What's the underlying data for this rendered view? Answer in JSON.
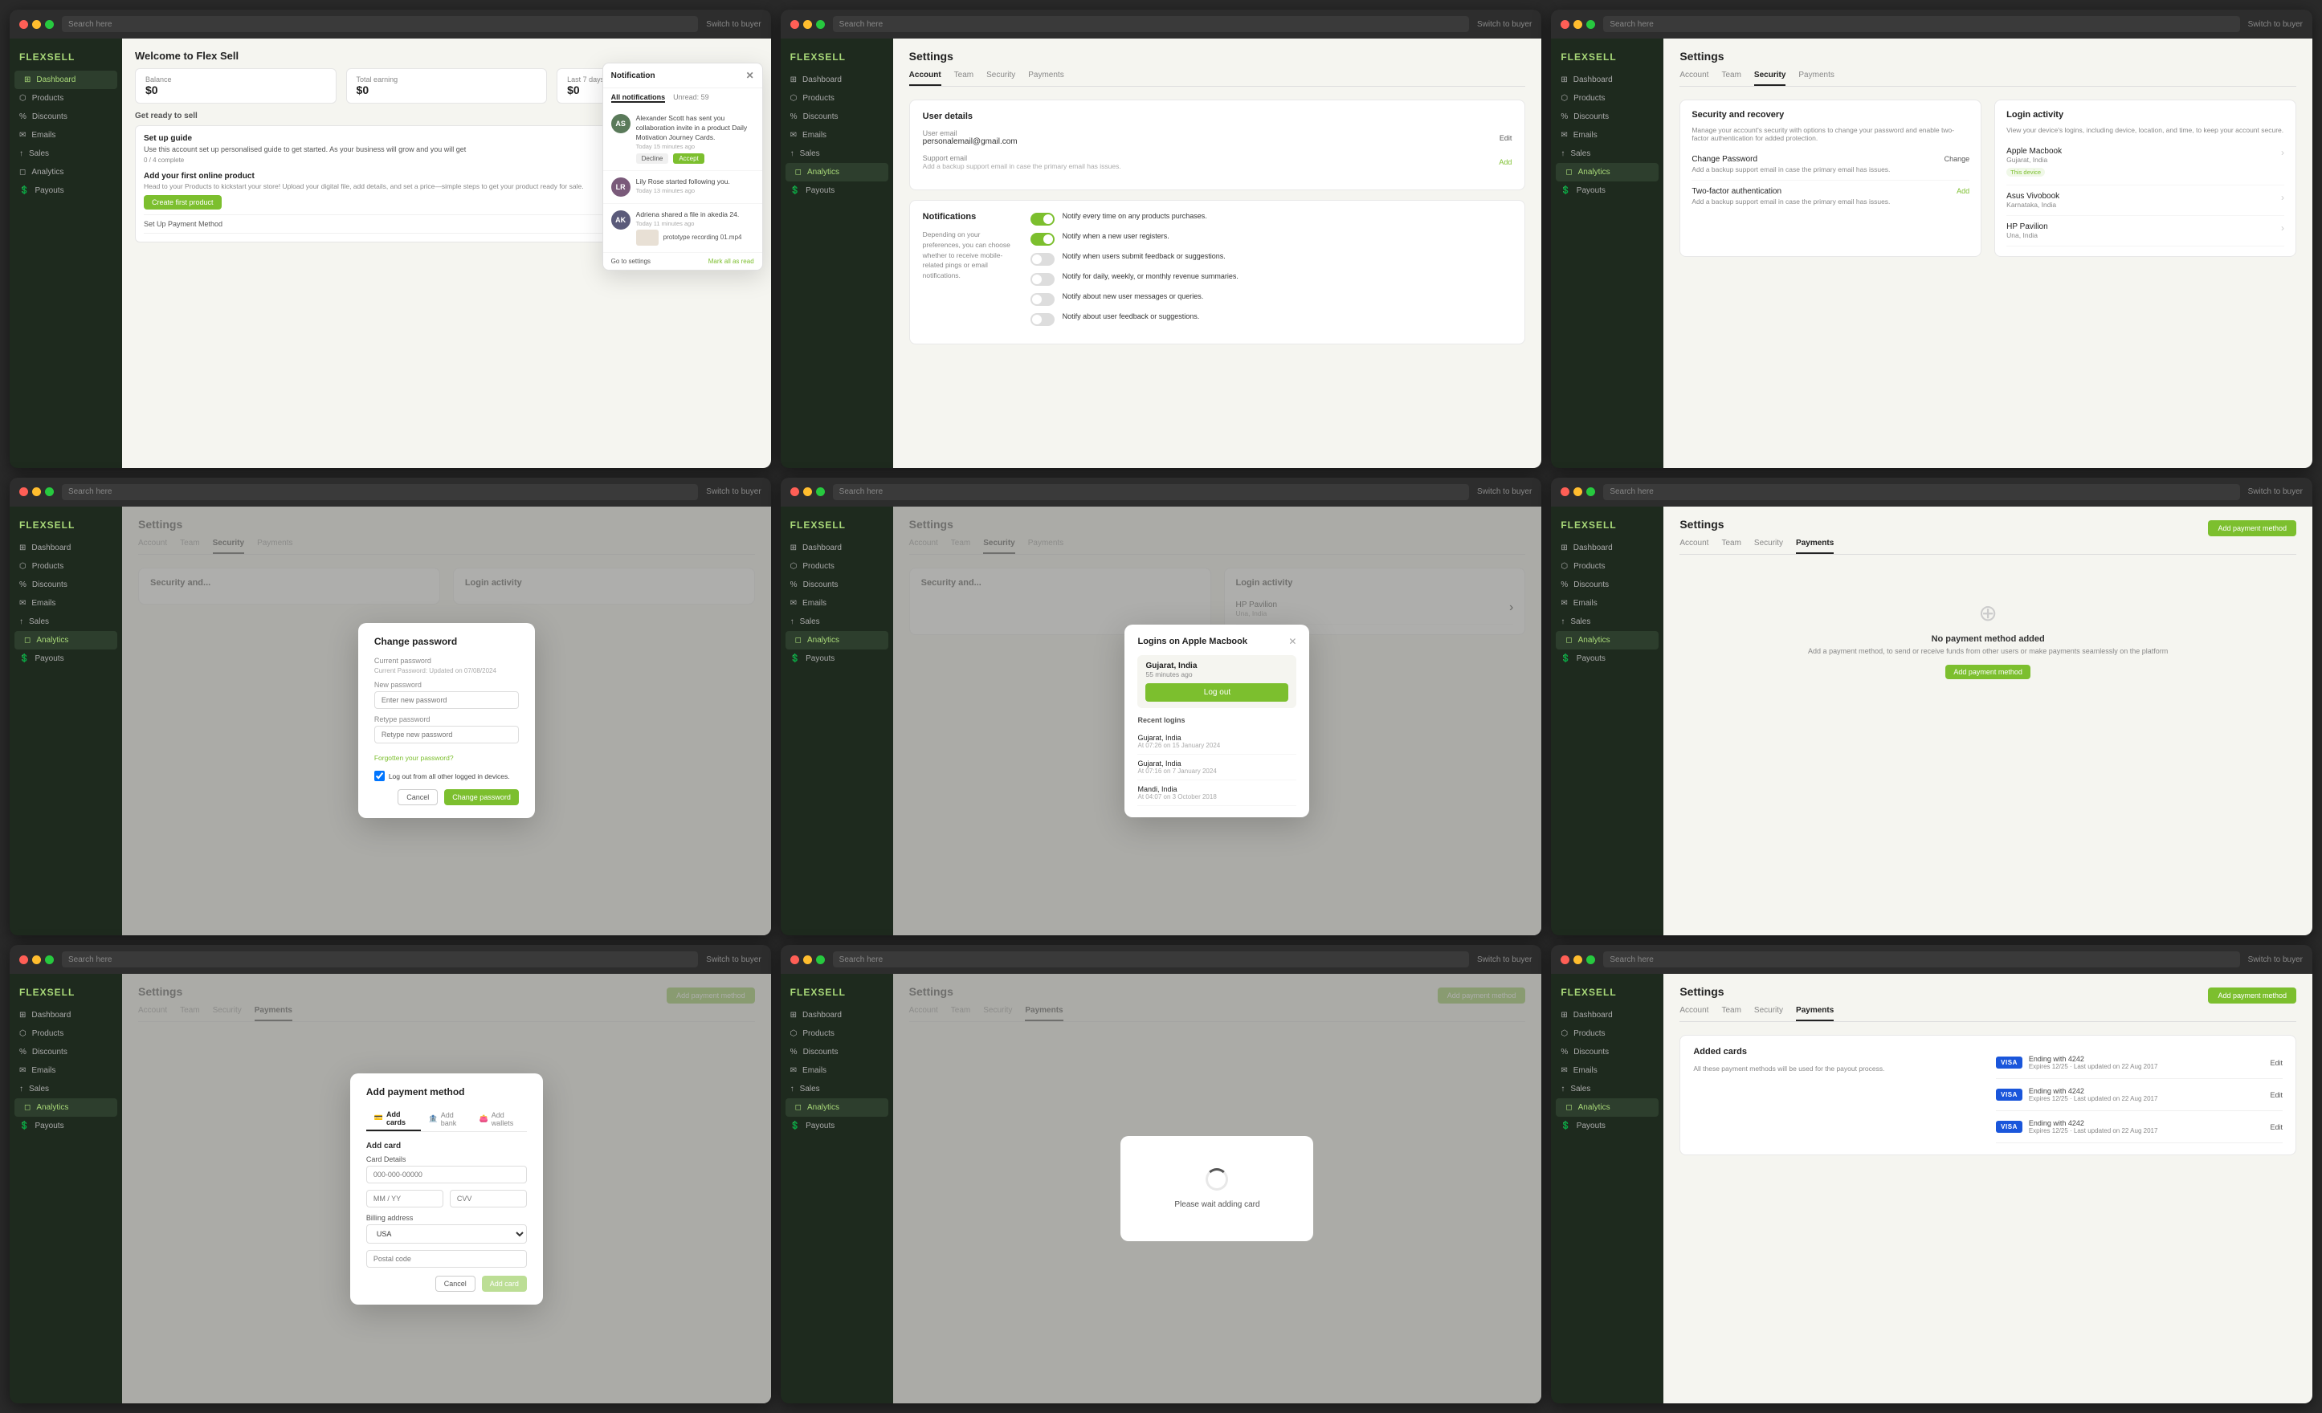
{
  "brand": "FLEXSELL",
  "search_placeholder": "Search here",
  "switch_to_buyer": "Switch to buyer",
  "sidebar": {
    "items": [
      {
        "label": "Dashboard",
        "icon": "⊞",
        "active": false
      },
      {
        "label": "Products",
        "icon": "⬡",
        "active": false
      },
      {
        "label": "Discounts",
        "icon": "%",
        "active": false
      },
      {
        "label": "Emails",
        "icon": "✉",
        "active": false
      },
      {
        "label": "Sales",
        "icon": "↑",
        "active": false
      },
      {
        "label": "Analytics",
        "icon": "◻",
        "active": true
      },
      {
        "label": "Payouts",
        "icon": "💲",
        "active": false
      }
    ]
  },
  "panel1": {
    "title": "Welcome to Flex Sell",
    "stats": [
      {
        "label": "Balance",
        "value": "$0"
      },
      {
        "label": "Total earning",
        "value": "$0"
      },
      {
        "label": "Last 7 days",
        "value": "$0"
      }
    ],
    "setup": {
      "title": "Get ready to sell",
      "subtitle": "Set up guide",
      "desc": "Use this account set up personalised guide to get started. As your business will grow and you will get",
      "progress": "0 / 4 complete",
      "items": [
        {
          "text": "Add your first online product",
          "desc": "Head to your Products to kickstart your store! Upload your digital file, add details, and set a price—simple steps to get your product ready for sale.",
          "btn": "Create first product"
        },
        {
          "text": "Set Up Payment Method"
        }
      ]
    },
    "notification": {
      "title": "Notification",
      "unread": "Unread: 59",
      "tabs": [
        "All notifications",
        "Unread 59"
      ],
      "items": [
        {
          "avatar_text": "AS",
          "avatar_color": "#5a7a5a",
          "text": "Alexander Scott has sent you collaboration invite in a product Daily Motivation Journey Cards.",
          "time": "Today 15 minutes ago",
          "actions": [
            "Decline",
            "Accept"
          ]
        },
        {
          "avatar_text": "LR",
          "avatar_color": "#7a5a7a",
          "text": "Lily Rose started following you.",
          "time": "Today 13 minutes ago"
        },
        {
          "avatar_text": "AK",
          "avatar_color": "#5a5a7a",
          "text": "Adriena shared a file in akedia 24.",
          "time": "Today 11 minutes ago",
          "has_attachment": true,
          "attachment": "prototype recording 01.mp4"
        }
      ],
      "footer": {
        "settings": "Go to settings",
        "mark_all": "Mark all as read"
      }
    }
  },
  "panel2": {
    "title": "Settings",
    "tabs": [
      "Account",
      "Team",
      "Security",
      "Payments"
    ],
    "active_tab": "Account",
    "user_details": {
      "title": "User details",
      "user_email_label": "User email",
      "user_email": "personalemail@gmail.com",
      "user_email_action": "Edit",
      "support_email_label": "Support email",
      "support_email_desc": "Add a backup support email in case the primary email has issues.",
      "support_email_action": "Add"
    },
    "notifications": {
      "title": "Notifications",
      "desc": "Depending on your preferences, you can choose whether to receive mobile-related pings or email notifications.",
      "items": [
        {
          "text": "Notify every time on any products purchases.",
          "enabled": true
        },
        {
          "text": "Notify when a new user registers.",
          "enabled": true
        },
        {
          "text": "Notify when users submit feedback or suggestions.",
          "enabled": false
        },
        {
          "text": "Notify for daily, weekly, or monthly revenue summaries.",
          "enabled": false
        },
        {
          "text": "Notify about new user messages or queries.",
          "enabled": false
        },
        {
          "text": "Notify about user feedback or suggestions.",
          "enabled": false
        }
      ]
    }
  },
  "panel3": {
    "title": "Settings",
    "tabs": [
      "Account",
      "Team",
      "Security",
      "Payments"
    ],
    "active_tab": "Security",
    "security_recovery": {
      "title": "Security and recovery",
      "desc": "Manage your account's security with options to change your password and enable two-factor authentication for added protection.",
      "items": [
        {
          "label": "Change Password",
          "desc": "Add a backup support email in case the primary email has issues.",
          "action": "Change"
        },
        {
          "label": "Two-factor authentication",
          "desc": "Add a backup support email in case the primary email has issues.",
          "action": "Add"
        }
      ]
    },
    "login_activity": {
      "title": "Login activity",
      "desc": "View your device's logins, including device, location, and time, to keep your account secure.",
      "devices": [
        {
          "name": "Apple Macbook",
          "location": "Gujarat, India",
          "badge": "This device"
        },
        {
          "name": "Asus Vivobook",
          "location": "Karnataka, India"
        },
        {
          "name": "HP Pavilion",
          "location": "Una, India"
        }
      ]
    }
  },
  "panel4": {
    "title": "Settings",
    "tabs": [
      "Account",
      "Team",
      "Security",
      "Payments"
    ],
    "active_tab": "Security",
    "change_password": {
      "title": "Change password",
      "current_label": "Current password",
      "current_desc": "Current Password: Updated on 07/08/2024",
      "new_label": "New password",
      "new_placeholder": "Enter new password",
      "retype_label": "Retype password",
      "retype_placeholder": "Retype new password",
      "forgot_link": "Forgotten your password?",
      "logout_all": "Log out from all other logged in devices.",
      "cancel": "Cancel",
      "change": "Change password"
    }
  },
  "panel5": {
    "title": "Settings",
    "tabs": [
      "Account",
      "Team",
      "Security",
      "Payments"
    ],
    "active_tab": "Security",
    "logins_popup": {
      "title": "Logins on Apple Macbook",
      "current": {
        "location": "Gujarat, India",
        "time": "55 minutes ago",
        "btn": "Log out"
      },
      "recent_title": "Recent logins",
      "recent": [
        {
          "location": "Gujarat, India",
          "time": "At 07:26 on 15 January 2024"
        },
        {
          "location": "Gujarat, India",
          "time": "At 07:16 on 7 January 2024"
        },
        {
          "location": "Mandi, India",
          "time": "At 04:07 on 3 October 2018"
        }
      ]
    }
  },
  "panel6": {
    "title": "Settings",
    "tabs": [
      "Account",
      "Team",
      "Security",
      "Payments"
    ],
    "active_tab": "Payments",
    "add_btn": "Add payment method",
    "no_payment": {
      "desc": "No payment method added",
      "sub": "Add a payment method, to send or receive funds from other users or make payments seamlessly on the platform",
      "btn": "Add payment method"
    }
  },
  "panel7": {
    "title": "Settings",
    "tabs": [
      "Account",
      "Team",
      "Security",
      "Payments"
    ],
    "active_tab": "Payments",
    "add_btn": "Add payment method",
    "add_payment": {
      "title": "Add payment method",
      "tabs": [
        "Add cards",
        "Add bank",
        "Add wallets"
      ],
      "active_tab": "Add cards",
      "card_section": "Add card",
      "card_details": "Card Details",
      "card_number_placeholder": "000-000-00000",
      "expiry_placeholder": "MM / YY",
      "cvv_placeholder": "CVV",
      "billing_address": "Billing address",
      "country": "USA",
      "postal_placeholder": "Postal code",
      "cancel": "Cancel",
      "add": "Add card"
    }
  },
  "panel8": {
    "title": "Settings",
    "tabs": [
      "Account",
      "Team",
      "Security",
      "Payments"
    ],
    "active_tab": "Payments",
    "add_btn": "Add payment method",
    "loading": {
      "text": "Please wait adding card"
    }
  },
  "panel9": {
    "title": "Settings",
    "tabs": [
      "Account",
      "Team",
      "Security",
      "Payments"
    ],
    "active_tab": "Payments",
    "add_btn": "Add payment method",
    "added_cards": {
      "title": "Added cards",
      "desc": "All these payment methods will be used for the payout process.",
      "cards": [
        {
          "ending": "Ending with 4242",
          "expires": "Expires 12/25",
          "updated": "Last updated on 22 Aug 2017",
          "action": "Edit"
        },
        {
          "ending": "Ending with 4242",
          "expires": "Expires 12/25",
          "updated": "Last updated on 22 Aug 2017",
          "action": "Edit"
        },
        {
          "ending": "Ending with 4242",
          "expires": "Expires 12/25",
          "updated": "Last updated on 22 Aug 2017",
          "action": "Edit"
        }
      ]
    }
  }
}
